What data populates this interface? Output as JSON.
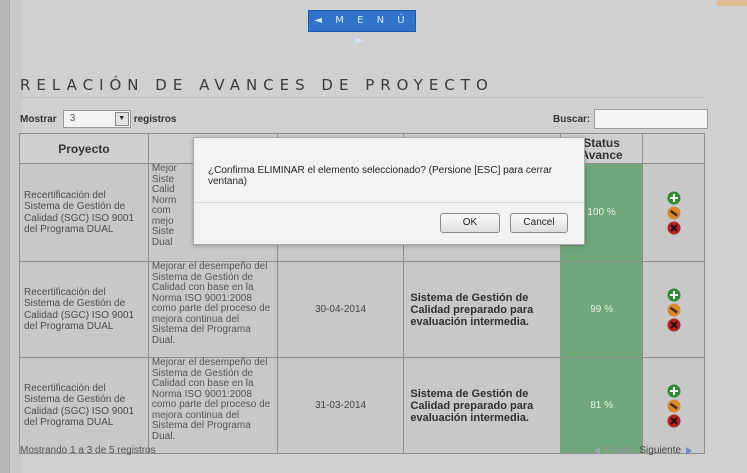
{
  "menu": {
    "label": "◄ M E N Ú ►"
  },
  "page_title": "RELACIÓN DE AVANCES DE PROYECTO",
  "controls": {
    "show_label": "Mostrar",
    "page_size": "3",
    "records_label": "registros",
    "search_label": "Buscar:",
    "search_value": ""
  },
  "table": {
    "headers": {
      "proyecto": "Proyecto",
      "status_line1": "Status",
      "status_line2": "Avance"
    },
    "rows": [
      {
        "proyecto": "Recertificación del Sistema de Gestión de Calidad (SGC) ISO 9001 del Programa DUAL",
        "descripcion": "Mejor Siste Calid Norm com mejo Siste Dual",
        "fecha": "",
        "avance": "",
        "status": "100 %"
      },
      {
        "proyecto": "Recertificación del Sistema de Gestión de Calidad (SGC) ISO 9001 del Programa DUAL",
        "descripcion": "Mejorar el desempeño del Sistema de Gestión de Calidad con base en la Norma ISO 9001:2008 como parte del proceso de mejora continua del Sistema del Programa Dual.",
        "fecha": "30-04-2014",
        "avance": "Sistema de Gestión de Calidad preparado para evaluación intermedia.",
        "status": "99 %"
      },
      {
        "proyecto": "Recertificación del Sistema de Gestión de Calidad (SGC) ISO 9001 del Programa DUAL",
        "descripcion": "Mejorar el desempeño del Sistema de Gestión de Calidad con base en la Norma ISO 9001:2008 como parte del proceso de mejora continua del Sistema del Programa Dual.",
        "fecha": "31-03-2014",
        "avance": "Sistema de Gestión de Calidad preparado para evaluación intermedia.",
        "status": "81 %"
      }
    ]
  },
  "footer": {
    "summary": "Mostrando 1 a 3 de 5 registros",
    "prev": "Previo",
    "next": "Siguiente"
  },
  "dialog": {
    "message": "¿Confirma ELIMINAR el elemento seleccionado? (Persione [ESC] para cerrar ventana)",
    "ok": "OK",
    "cancel": "Cancel"
  },
  "colors": {
    "menu_blue": "#2f74c9",
    "status_green": "#6fa77a",
    "add_green": "#2e8b2e",
    "edit_orange": "#d9892b",
    "delete_red": "#b32323"
  },
  "icons": [
    "add-icon",
    "edit-icon",
    "delete-icon",
    "prev-arrow-icon",
    "next-arrow-icon",
    "dropdown-arrow-icon"
  ]
}
